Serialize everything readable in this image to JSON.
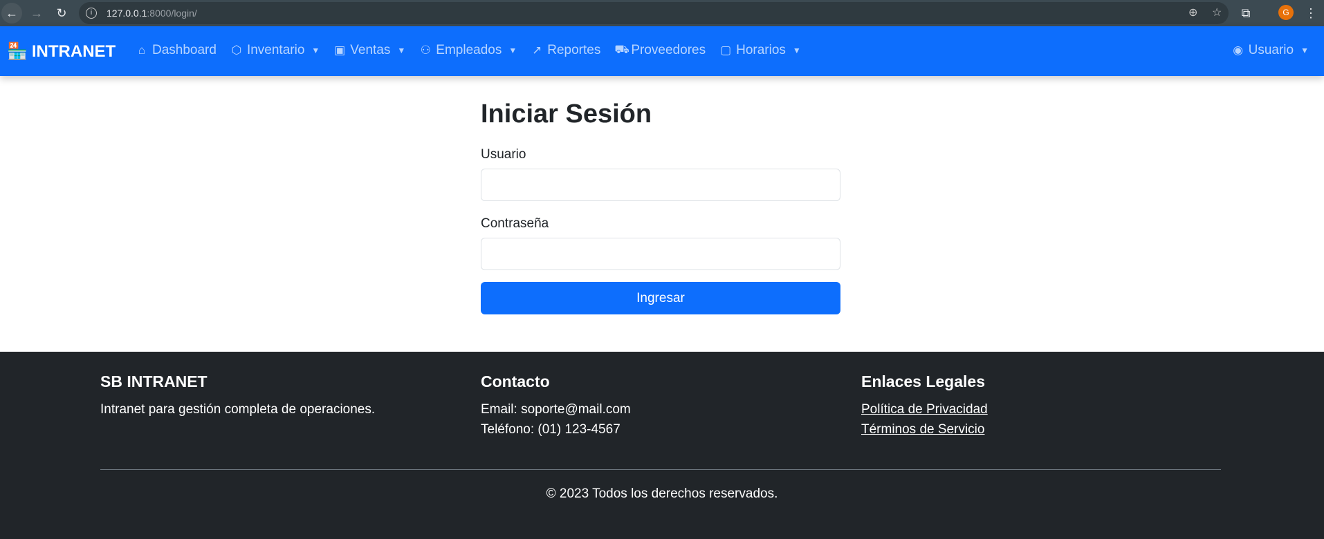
{
  "browser": {
    "url_host": "127.0.0.1",
    "url_rest": ":8000/login/",
    "profile_initial": "G"
  },
  "navbar": {
    "brand": "INTRANET",
    "items": [
      {
        "label": "Dashboard",
        "icon": "house-icon",
        "dropdown": false
      },
      {
        "label": "Inventario",
        "icon": "box-icon",
        "dropdown": true
      },
      {
        "label": "Ventas",
        "icon": "cash-icon",
        "dropdown": true
      },
      {
        "label": "Empleados",
        "icon": "people-icon",
        "dropdown": true
      },
      {
        "label": "Reportes",
        "icon": "graph-icon",
        "dropdown": false
      },
      {
        "label": "Proveedores",
        "icon": "truck-icon",
        "dropdown": false
      },
      {
        "label": "Horarios",
        "icon": "calendar-icon",
        "dropdown": true
      }
    ],
    "user": "Usuario"
  },
  "login": {
    "title": "Iniciar Sesión",
    "username_label": "Usuario",
    "username_value": "",
    "password_label": "Contraseña",
    "password_value": "",
    "submit": "Ingresar"
  },
  "footer": {
    "brand_title": "SB INTRANET",
    "brand_text": "Intranet para gestión completa de operaciones.",
    "contact_title": "Contacto",
    "email": "Email: soporte@mail.com",
    "phone": "Teléfono: (01) 123-4567",
    "legal_title": "Enlaces Legales",
    "privacy": "Política de Privacidad",
    "terms": "Términos de Servicio",
    "copyright": "© 2023 Todos los derechos reservados."
  }
}
